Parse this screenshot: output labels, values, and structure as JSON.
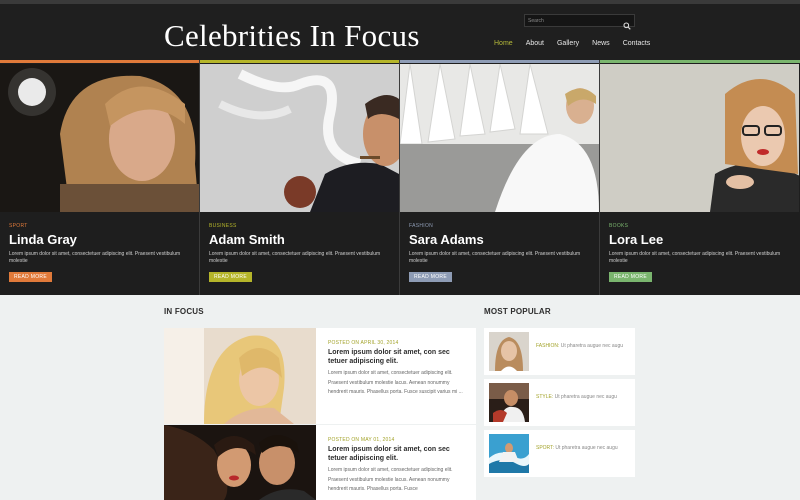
{
  "header": {
    "site_title": "Celebrities In Focus",
    "search_placeholder": "Search",
    "nav": [
      {
        "label": "Home",
        "active": true
      },
      {
        "label": "About",
        "active": false
      },
      {
        "label": "Gallery",
        "active": false
      },
      {
        "label": "News",
        "active": false
      },
      {
        "label": "Contacts",
        "active": false
      }
    ]
  },
  "featured": [
    {
      "category": "SPORT",
      "name": "Linda Gray",
      "description": "Lorem ipsum dolor sit amet, consectetuer adipiscing elit. Praesent vestibulum molestie",
      "button": "READ MORE",
      "accent": "#e07a3a"
    },
    {
      "category": "BUSINESS",
      "name": "Adam Smith",
      "description": "Lorem ipsum dolor sit amet, consectetuer adipiscing elit. Praesent vestibulum molestie",
      "button": "READ MORE",
      "accent": "#b5b52a"
    },
    {
      "category": "FASHION",
      "name": "Sara Adams",
      "description": "Lorem ipsum dolor sit amet, consectetuer adipiscing elit. Praesent vestibulum molestie",
      "button": "READ MORE",
      "accent": "#8e9cb5"
    },
    {
      "category": "BOOKS",
      "name": "Lora Lee",
      "description": "Lorem ipsum dolor sit amet, consectetuer adipiscing elit. Praesent vestibulum molestie",
      "button": "READ MORE",
      "accent": "#7ab56e"
    }
  ],
  "in_focus": {
    "title": "IN FOCUS",
    "items": [
      {
        "posted": "POSTED ON APRIL 30, 2014",
        "headline": "Lorem ipsum dolor sit amet, con sec tetuer adipiscing elit.",
        "body": "Lorem ipsum dolor sit amet, consectetuer adipiscing elit. Praesent vestibulum molestie lacus. Aenean nonummy hendrerit mauris. Phasellus porta. Fusce suscipit varius mi ..."
      },
      {
        "posted": "POSTED ON MAY 01, 2014",
        "headline": "Lorem ipsum dolor sit amet, con sec tetuer adipiscing elit.",
        "body": "Lorem ipsum dolor sit amet, consectetuer adipiscing elit. Praesent vestibulum molestie lacus. Aenean nonummy hendrerit mauris. Phasellus porta. Fusce"
      }
    ]
  },
  "most_popular": {
    "title": "MOST POPULAR",
    "items": [
      {
        "label": "FASHION:",
        "text": "Ut pharetra augue nec augu"
      },
      {
        "label": "STYLE:",
        "text": "Ut pharetra augue nec augu"
      },
      {
        "label": "SPORT:",
        "text": "Ut pharetra augue nec augu"
      }
    ]
  },
  "colors": {
    "header_bg": "#1f1f1f",
    "nav_active": "#b4b83a",
    "posted_text": "#a3a32a",
    "page_bg": "#eef1f1"
  }
}
